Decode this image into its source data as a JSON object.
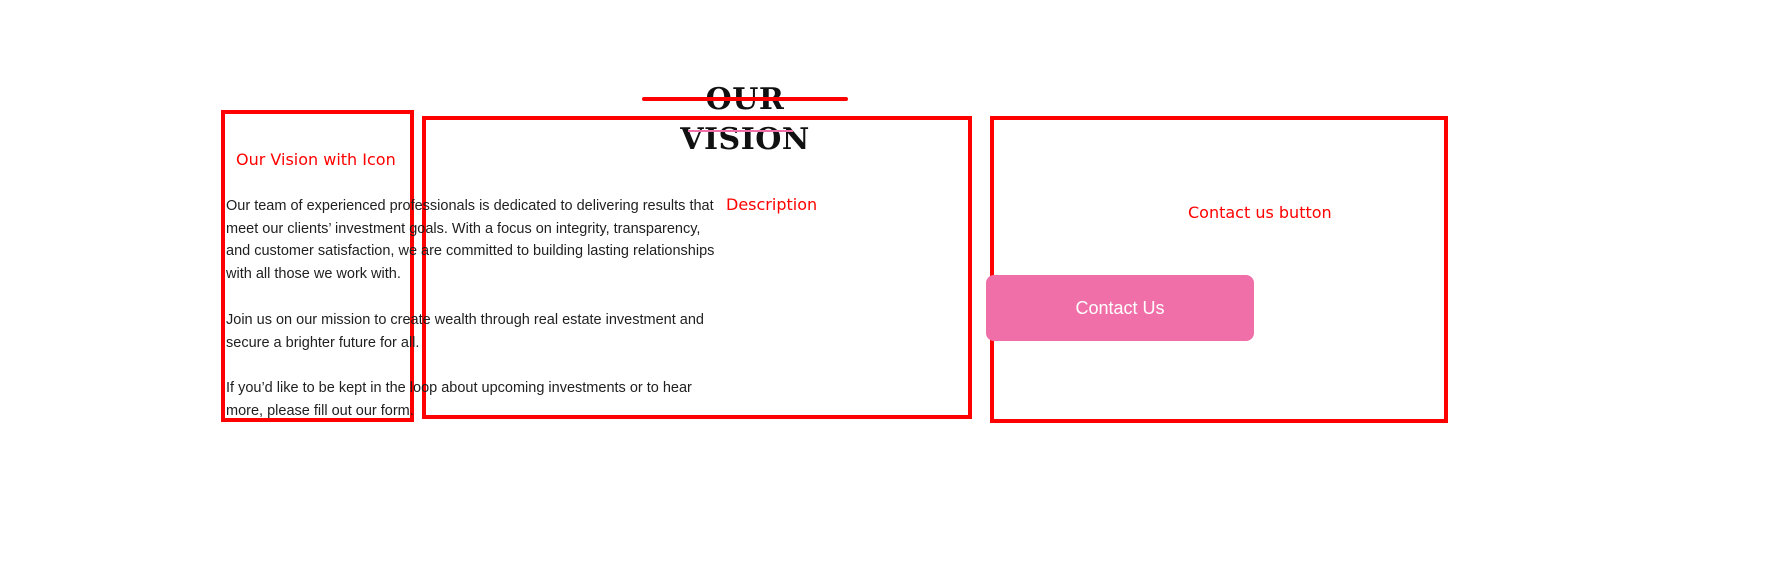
{
  "section": {
    "title": "OUR VISION"
  },
  "annotations": {
    "vision_icon_label": "Our Vision with Icon",
    "description_label": "Description",
    "contact_button_label": "Contact us button"
  },
  "description": {
    "paragraphs": [
      "Our team of experienced professionals is dedicated to delivering results that meet our clients’ investment goals. With a focus on integrity, transparency, and customer satisfaction, we are committed to building lasting relationships with all those we work with.",
      "Join us on our mission to create wealth through real estate investment and secure a brighter future for all.",
      "If you’d like to be kept in the loop about upcoming investments or to hear more, please fill out our form."
    ]
  },
  "contact": {
    "button_label": "Contact Us"
  },
  "colors": {
    "accent": "#f06fa8",
    "annotation": "#ff0000",
    "text": "#1f1f1f"
  }
}
